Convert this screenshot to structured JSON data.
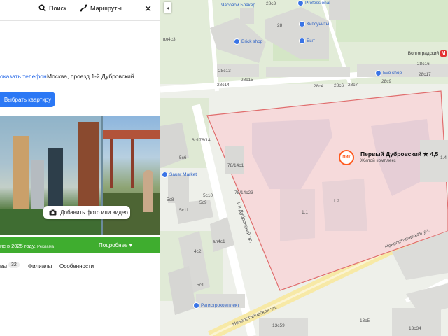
{
  "toolbar": {
    "search_label": "Поиск",
    "routes_label": "Маршруты",
    "close_glyph": "✕",
    "collapse_glyph": "◂"
  },
  "listing": {
    "phone_link": "оказать телефон",
    "address": "Москва, проезд 1-й Дубровский",
    "choose_apartment": "Выбрать квартиру",
    "add_photo": "Добавить фото или видео",
    "status_text": "ис в 2025 году.",
    "status_small": "Реклама",
    "status_more": "Подробнее ▾"
  },
  "tabs": [
    {
      "label": "вы"
    },
    {
      "label": "Филиалы"
    },
    {
      "label": "Особенности"
    }
  ],
  "reviews_count": "32",
  "map": {
    "marker_logo": "ПИК",
    "marker_title": "Первый Дубровский ★ 4,5",
    "marker_subtitle": "Жилой комплекс",
    "metro_label": "Волгоградский",
    "metro_glyph": "М",
    "pois": [
      {
        "label": "Brick shop"
      },
      {
        "label": "Кипсуниты"
      },
      {
        "label": "Быт"
      },
      {
        "label": "Evo shop"
      },
      {
        "label": "Professional"
      },
      {
        "label": "Sauer Market"
      },
      {
        "label": "Регистрокомплект"
      },
      {
        "label": "Часовой Бракер"
      }
    ],
    "streets": {
      "novoostap1": "Новоостаповская ул.",
      "novoostap2": "Новоостаповская ул.",
      "dubrovsky": "1-й Дубровский пр."
    },
    "labels": [
      {
        "text": "28с3"
      },
      {
        "text": "28"
      },
      {
        "text": "28с13"
      },
      {
        "text": "28с14"
      },
      {
        "text": "28с4"
      },
      {
        "text": "28с6"
      },
      {
        "text": "28с7"
      },
      {
        "text": "28с9"
      },
      {
        "text": "28с16"
      },
      {
        "text": "28с17"
      },
      {
        "text": "28с15"
      },
      {
        "text": "78/14с1"
      },
      {
        "text": "78/14с23"
      },
      {
        "text": "1.1"
      },
      {
        "text": "1.2"
      },
      {
        "text": "5с8"
      },
      {
        "text": "5с6"
      },
      {
        "text": "5с10"
      },
      {
        "text": "5с11"
      },
      {
        "text": "4с2"
      },
      {
        "text": "5с9"
      },
      {
        "text": "вл4с1"
      },
      {
        "text": "5с1"
      },
      {
        "text": "вл4с3"
      },
      {
        "text": "6с178/14"
      },
      {
        "text": "13с59"
      },
      {
        "text": "13с5"
      },
      {
        "text": "13с34"
      },
      {
        "text": "1.4"
      }
    ]
  },
  "colors": {
    "accent_blue": "#2b78f5",
    "status_green": "#3fad2f",
    "project_zone": "#f6dadb",
    "pik_orange": "#ff5a1f"
  }
}
